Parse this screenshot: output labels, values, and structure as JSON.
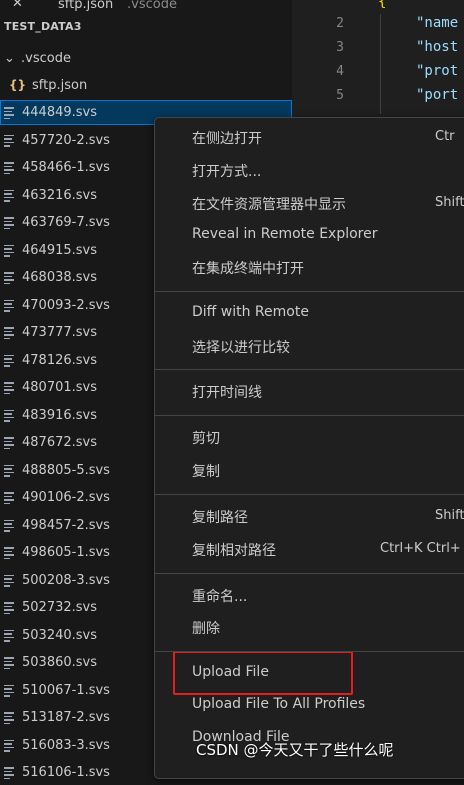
{
  "tab": {
    "close_glyph": "✕",
    "filename": "sftp.json",
    "folder": ".vscode"
  },
  "explorer": {
    "section_title": "TEST_DATA3",
    "folder": {
      "chevron": "⌄",
      "label": ".vscode"
    },
    "json_file": {
      "icon": "{}",
      "label": "sftp.json"
    },
    "files": [
      "444849.svs",
      "457720-2.svs",
      "458466-1.svs",
      "463216.svs",
      "463769-7.svs",
      "464915.svs",
      "468038.svs",
      "470093-2.svs",
      "473777.svs",
      "478126.svs",
      "480701.svs",
      "483916.svs",
      "487672.svs",
      "488805-5.svs",
      "490106-2.svs",
      "498457-2.svs",
      "498605-1.svs",
      "500208-3.svs",
      "502732.svs",
      "503240.svs",
      "503860.svs",
      "510067-1.svs",
      "513187-2.svs",
      "516083-3.svs",
      "516106-1.svs"
    ],
    "selected_index": 0
  },
  "editor": {
    "line_numbers": [
      "2",
      "3",
      "4",
      "5"
    ],
    "lines": [
      "\"name",
      "\"host",
      "\"prot",
      "\"port"
    ],
    "open_brace": "{"
  },
  "context_menu": {
    "groups": [
      [
        {
          "label": "在侧边打开",
          "shortcut": "Ctr"
        },
        {
          "label": "打开方式...",
          "shortcut": ""
        },
        {
          "label": "在文件资源管理器中显示",
          "shortcut": "Shift"
        },
        {
          "label": "Reveal in Remote Explorer",
          "shortcut": ""
        },
        {
          "label": "在集成终端中打开",
          "shortcut": ""
        }
      ],
      [
        {
          "label": "Diff with Remote",
          "shortcut": ""
        },
        {
          "label": "选择以进行比较",
          "shortcut": ""
        }
      ],
      [
        {
          "label": "打开时间线",
          "shortcut": ""
        }
      ],
      [
        {
          "label": "剪切",
          "shortcut": ""
        },
        {
          "label": "复制",
          "shortcut": ""
        }
      ],
      [
        {
          "label": "复制路径",
          "shortcut": "Shift"
        },
        {
          "label": "复制相对路径",
          "shortcut": "Ctrl+K Ctrl+"
        }
      ],
      [
        {
          "label": "重命名...",
          "shortcut": ""
        },
        {
          "label": "删除",
          "shortcut": ""
        }
      ],
      [
        {
          "label": "Upload File",
          "shortcut": ""
        },
        {
          "label": "Upload File To All Profiles",
          "shortcut": ""
        },
        {
          "label": "Download File",
          "shortcut": ""
        }
      ]
    ]
  },
  "watermark": "CSDN @今天又干了些什么呢",
  "colors": {
    "accent": "#0078d4",
    "highlight": "#e02020",
    "background": "#181818"
  }
}
